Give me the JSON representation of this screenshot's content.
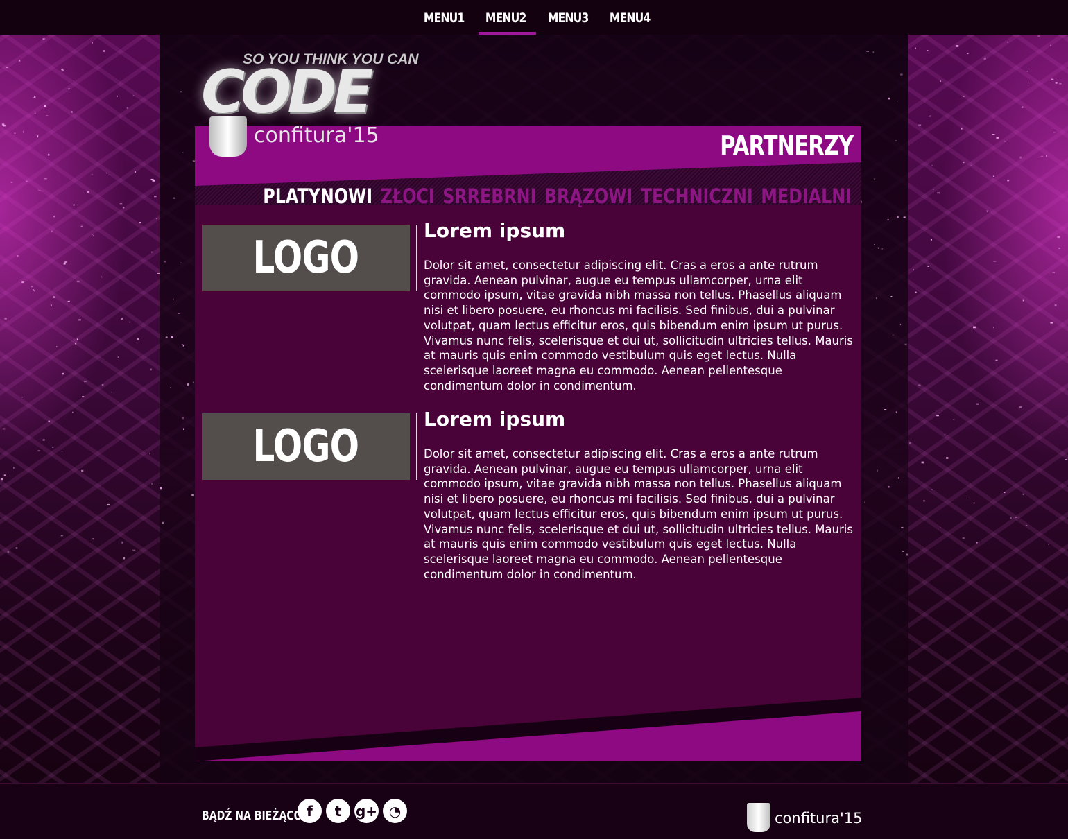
{
  "nav": {
    "items": [
      {
        "label": "MENU1"
      },
      {
        "label": "MENU2"
      },
      {
        "label": "MENU3"
      },
      {
        "label": "MENU4"
      }
    ],
    "active": "MENU2"
  },
  "brand": {
    "tagline": "SO YOU THINK YOU CAN",
    "code": "CODE",
    "event": "confitura'15"
  },
  "page": {
    "title": "PARTNERZY"
  },
  "tabs": [
    {
      "label": "PLATYNOWI",
      "active": true
    },
    {
      "label": "ZŁOCI",
      "active": false
    },
    {
      "label": "SRREBRNI",
      "active": false
    },
    {
      "label": "BRĄZOWI",
      "active": false
    },
    {
      "label": "TECHNICZNI",
      "active": false
    },
    {
      "label": "MEDIALNI",
      "active": false
    }
  ],
  "partners": [
    {
      "logo": "LOGO",
      "name": "Lorem ipsum",
      "description": "Dolor sit amet, consectetur adipiscing elit. Cras a eros a ante rutrum gravida. Aenean pulvinar, augue eu tempus ullamcorper, urna elit commodo ipsum, vitae gravida nibh massa non tellus. Phasellus aliquam nisi et libero posuere, eu rhoncus mi facilisis. Sed finibus, dui a pulvinar volutpat, quam lectus efficitur eros, quis bibendum enim ipsum ut purus. Vivamus nunc felis, scelerisque et dui ut, sollicitudin ultricies tellus. Mauris at mauris quis enim commodo vestibulum quis eget lectus. Nulla scelerisque laoreet magna eu commodo. Aenean pellentesque condimentum dolor in condimentum."
    },
    {
      "logo": "LOGO",
      "name": "Lorem ipsum",
      "description": "Dolor sit amet, consectetur adipiscing elit. Cras a eros a ante rutrum gravida. Aenean pulvinar, augue eu tempus ullamcorper, urna elit commodo ipsum, vitae gravida nibh massa non tellus. Phasellus aliquam nisi et libero posuere, eu rhoncus mi facilisis. Sed finibus, dui a pulvinar volutpat, quam lectus efficitur eros, quis bibendum enim ipsum ut purus. Vivamus nunc felis, scelerisque et dui ut, sollicitudin ultricies tellus. Mauris at mauris quis enim commodo vestibulum quis eget lectus. Nulla scelerisque laoreet magna eu commodo. Aenean pellentesque condimentum dolor in condimentum."
    }
  ],
  "footer": {
    "follow_label": "BĄDŹ NA BIEŻĄCO:",
    "social": [
      {
        "icon": "facebook-icon",
        "glyph": "f"
      },
      {
        "icon": "twitter-icon",
        "glyph": "t"
      },
      {
        "icon": "google-plus-icon",
        "glyph": "g+"
      },
      {
        "icon": "picasa-icon",
        "glyph": "◔"
      }
    ],
    "brand": "confitura'15"
  },
  "colors": {
    "accent": "#8e0a83",
    "panel": "#4a0339",
    "topbar": "#14010f",
    "logo_box": "#534d4c"
  }
}
